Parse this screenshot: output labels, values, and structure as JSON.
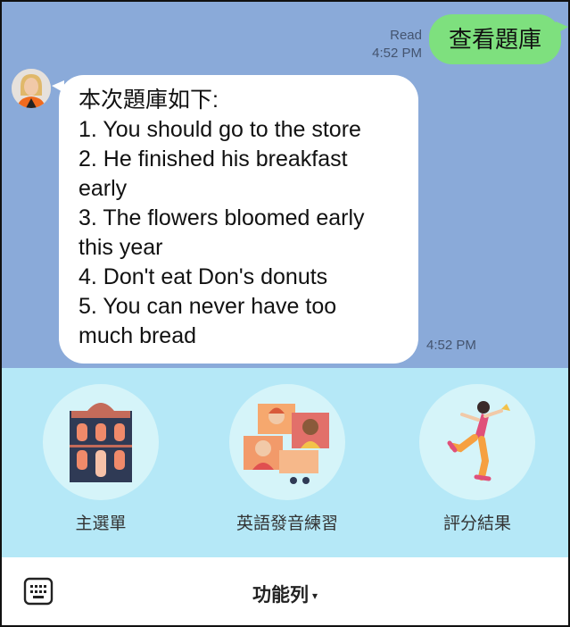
{
  "chat": {
    "sent_message": {
      "status": "Read",
      "time": "4:52 PM",
      "text": "查看題庫"
    },
    "received_message": {
      "lines": [
        "本次題庫如下:",
        "1. You should go to the store",
        "2. He finished his breakfast",
        "early",
        "3. The flowers bloomed early",
        "this year",
        "4. Don't eat Don's donuts",
        "5. You can never have too",
        "much bread"
      ],
      "time": "4:52 PM",
      "avatar_icon": "user-avatar"
    }
  },
  "rich_menu": {
    "items": [
      {
        "label": "主選單",
        "icon": "building-icon"
      },
      {
        "label": "英語發音練習",
        "icon": "people-video-icon"
      },
      {
        "label": "評分結果",
        "icon": "dancer-icon"
      }
    ]
  },
  "bottom_bar": {
    "toggle_label": "功能列",
    "caret": "▾",
    "keyboard_icon": "keyboard-icon"
  },
  "colors": {
    "chat_bg": "#8aaad9",
    "sent_bubble": "#7ee07e",
    "menu_bg": "#b5e8f7",
    "menu_circle": "#d5f4f9"
  }
}
